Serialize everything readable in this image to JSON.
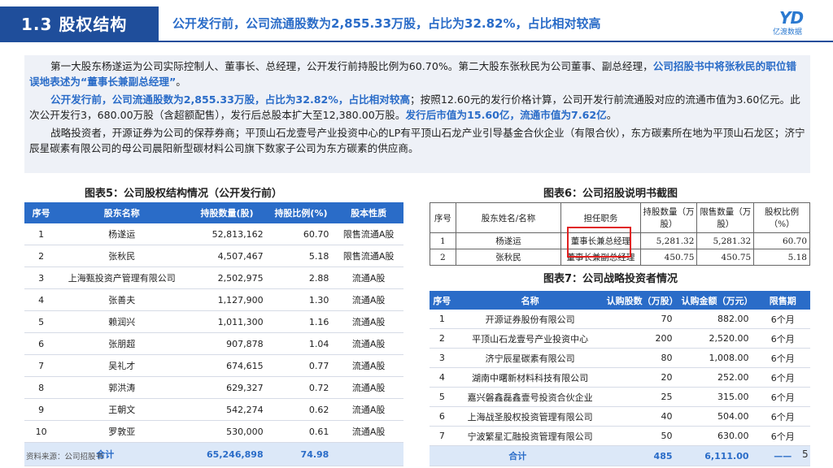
{
  "header": {
    "section": "1.3 股权结构",
    "title": "公开发行前，公司流通股数为2,855.33万股，占比为32.82%，占比相对较高",
    "logo_text": "亿渡数据"
  },
  "body": {
    "p1_a": "第一大股东杨遂运为公司实际控制人、董事长、总经理，公开发行前持股比例为60.70%。第二大股东张秋民为公司董事、副总经理，",
    "p1_b": "公司招股书中将张秋民的职位错误地表述为“董事长兼副总经理”",
    "p1_c": "。",
    "p2_a": "公开发行前，公司流通股数为2,855.33万股，占比为32.82%，占比相对较高",
    "p2_b": "；按照12.60元的发行价格计算，公司开发行前流通股对应的流通市值为3.60亿元。此次公开发行3，680.00万股（含超额配售），发行后总股本扩大至12,380.00万股。",
    "p2_c": "发行后市值为15.60亿，流通市值为7.62亿",
    "p2_d": "。",
    "p3": "战略投资者，开源证券为公司的保荐券商；平顶山石龙壹号产业投资中心的LP有平顶山石龙产业引导基金合伙企业（有限合伙），东方碳素所在地为平顶山石龙区；济宁辰星碳素有限公司的母公司晨阳新型碳材料公司旗下数家子公司为东方碳素的供应商。"
  },
  "table5": {
    "caption": "图表5：公司股权结构情况（公开发行前）",
    "headers": [
      "序号",
      "股东名称",
      "持股数量(股)",
      "持股比例(%)",
      "股本性质"
    ],
    "rows": [
      [
        "1",
        "杨遂运",
        "52,813,162",
        "60.70",
        "限售流通A股"
      ],
      [
        "2",
        "张秋民",
        "4,507,467",
        "5.18",
        "限售流通A股"
      ],
      [
        "3",
        "上海甄投资产管理有限公司",
        "2,502,975",
        "2.88",
        "流通A股"
      ],
      [
        "4",
        "张善夫",
        "1,127,900",
        "1.30",
        "流通A股"
      ],
      [
        "5",
        "赖润兴",
        "1,011,300",
        "1.16",
        "流通A股"
      ],
      [
        "6",
        "张朋超",
        "907,878",
        "1.04",
        "流通A股"
      ],
      [
        "7",
        "吴礼才",
        "674,615",
        "0.77",
        "流通A股"
      ],
      [
        "8",
        "郭洪涛",
        "629,327",
        "0.72",
        "流通A股"
      ],
      [
        "9",
        "王朝文",
        "542,274",
        "0.62",
        "流通A股"
      ],
      [
        "10",
        "罗敦亚",
        "530,000",
        "0.61",
        "流通A股"
      ]
    ],
    "total": [
      "合计",
      "65,246,898",
      "74.98"
    ]
  },
  "table6": {
    "caption": "图表6：公司招股说明书截图",
    "headers": [
      "序号",
      "股东姓名/名称",
      "担任职务",
      "持股数量（万股）",
      "限售数量（万股）",
      "股权比例（%）"
    ],
    "rows": [
      [
        "1",
        "杨遂运",
        "董事长兼总经理",
        "5,281.32",
        "5,281.32",
        "60.70"
      ],
      [
        "2",
        "张秋民",
        "董事长兼副总经理",
        "450.75",
        "450.75",
        "5.18"
      ]
    ]
  },
  "table7": {
    "caption": "图表7：公司战略投资者情况",
    "headers": [
      "序号",
      "名称",
      "认购股数（万股）",
      "认购金额（万元）",
      "限售期"
    ],
    "rows": [
      [
        "1",
        "开源证券股份有限公司",
        "70",
        "882.00",
        "6个月"
      ],
      [
        "2",
        "平顶山石龙壹号产业投资中心",
        "200",
        "2,520.00",
        "6个月"
      ],
      [
        "3",
        "济宁辰星碳素有限公司",
        "80",
        "1,008.00",
        "6个月"
      ],
      [
        "4",
        "湖南中曙新材料科技有限公司",
        "20",
        "252.00",
        "6个月"
      ],
      [
        "5",
        "嘉兴磐鑫磊鑫壹号投资合伙企业",
        "25",
        "315.00",
        "6个月"
      ],
      [
        "6",
        "上海战圣股权投资管理有限公司",
        "40",
        "504.00",
        "6个月"
      ],
      [
        "7",
        "宁波繁星汇融投资管理有限公司",
        "50",
        "630.00",
        "6个月"
      ]
    ],
    "total": [
      "合计",
      "485",
      "6,111.00",
      "——"
    ]
  },
  "footer": {
    "source": "资料来源：公司招股书",
    "page": "5"
  }
}
